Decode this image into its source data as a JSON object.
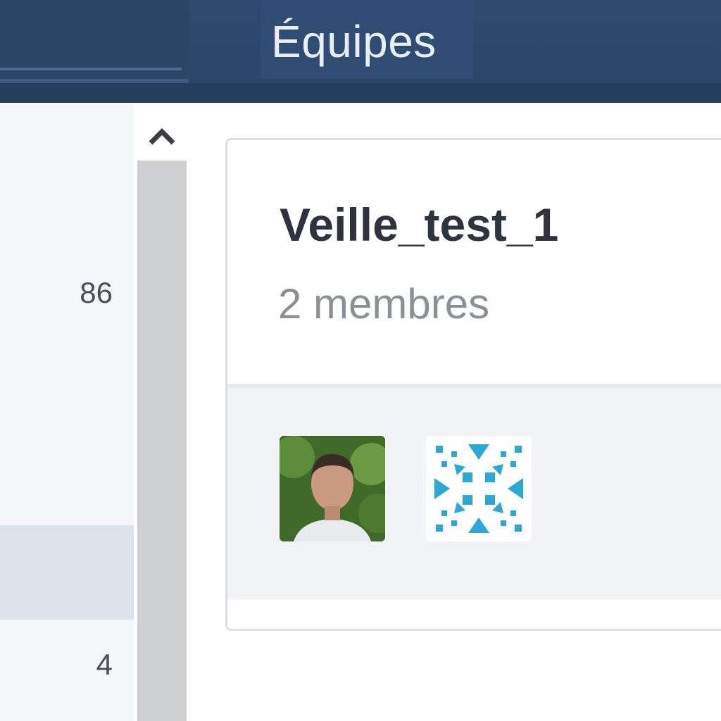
{
  "nav": {
    "active_tab_label": "Équipes"
  },
  "sidebar": {
    "counts": [
      "86",
      "4"
    ]
  },
  "team_card": {
    "name": "Veille_test_1",
    "member_count_label": "2 membres",
    "members": [
      {
        "avatar": "photo-avatar-icon"
      },
      {
        "avatar": "identicon-avatar-icon"
      }
    ]
  },
  "colors": {
    "topbar": "#2e4a6e",
    "identicon": "#2aa8d8"
  }
}
